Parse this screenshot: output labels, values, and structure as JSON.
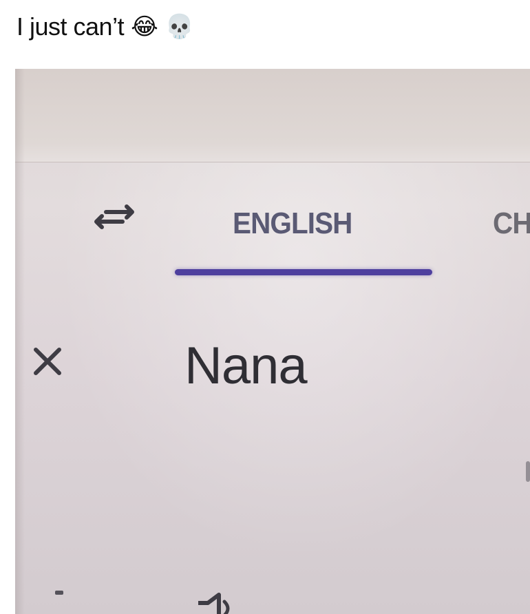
{
  "caption": {
    "text": "I just can’t",
    "emojis": "😂 💀"
  },
  "translator": {
    "tabs": [
      {
        "label": "ENGLISH",
        "selected": true
      },
      {
        "label": "CH",
        "selected": false
      }
    ],
    "input_text": "Nana",
    "icons": {
      "swap": "swap-languages-icon",
      "clear": "close-icon",
      "bottom": "speaker-icon"
    },
    "colors": {
      "accent": "#4e3f9e",
      "text": "#2f2e34"
    }
  }
}
